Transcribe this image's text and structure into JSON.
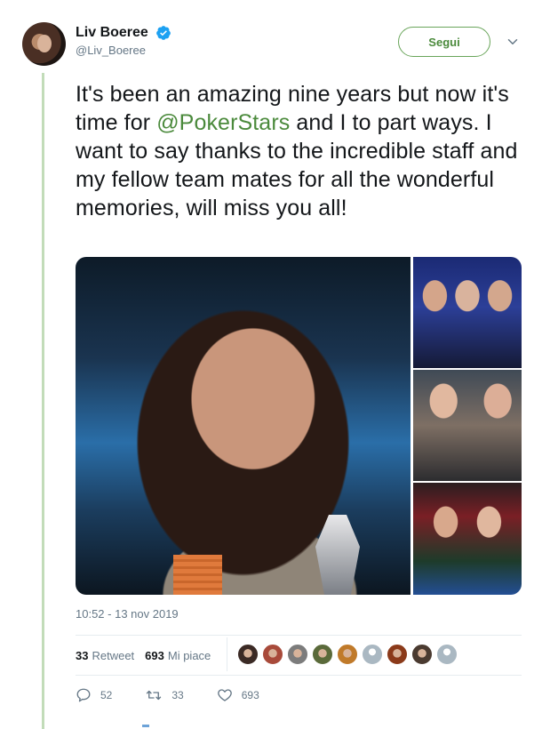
{
  "tweet": {
    "author": {
      "display_name": "Liv Boeree",
      "handle": "@Liv_Boeree",
      "verified": true
    },
    "follow_button": "Segui",
    "text_before": "It's been an amazing nine years but now it's time for ",
    "mention": "@PokerStars",
    "text_after": " and I to part ways. I want to say thanks to the incredible staff and my fellow team mates for all the wonderful memories, will miss you all!",
    "timestamp": "10:52 - 13 nov 2019",
    "stats": {
      "retweets_count": "33",
      "retweets_label": "Retweet",
      "likes_count": "693",
      "likes_label": "Mi piace"
    },
    "actions": {
      "reply_count": "52",
      "retweet_count": "33",
      "like_count": "693"
    }
  },
  "colors": {
    "accent": "#4b8a3c",
    "thread_line": "#c2dcb9",
    "muted_text": "#657786",
    "verified_blue": "#1da1f2"
  },
  "likers": [
    {
      "icon": "avatar-1",
      "color": "#3b2a25"
    },
    {
      "icon": "avatar-2",
      "color": "#a84a3a"
    },
    {
      "icon": "avatar-3",
      "color": "#7c7c7c"
    },
    {
      "icon": "avatar-4",
      "color": "#5a6a3a"
    },
    {
      "icon": "avatar-5",
      "color": "#c07a2a"
    },
    {
      "icon": "avatar-6-default",
      "color": "#aab8c2"
    },
    {
      "icon": "avatar-7",
      "color": "#8b3a1a"
    },
    {
      "icon": "avatar-8",
      "color": "#4a3a30"
    },
    {
      "icon": "avatar-9-default",
      "color": "#aab8c2"
    }
  ]
}
